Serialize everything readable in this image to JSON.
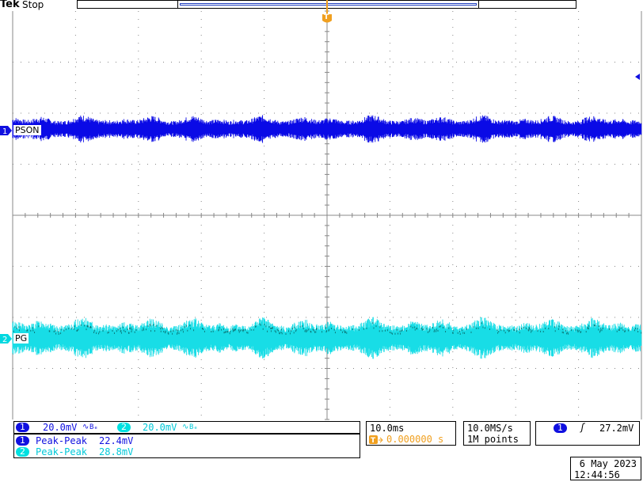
{
  "header": {
    "brand": "Tek",
    "status": "Stop"
  },
  "trigger_marker": {
    "label": "T"
  },
  "channels": [
    {
      "id": "1",
      "label": "PSON",
      "color": "#0a0ae6",
      "scale": "20.0mV",
      "coupling_symbol": "∿",
      "bw_symbol": "Bₑ"
    },
    {
      "id": "2",
      "label": "PG",
      "color": "#18dde6",
      "scale": "20.0mV",
      "coupling_symbol": "∿",
      "bw_symbol": "Bₑ"
    }
  ],
  "measurements": [
    {
      "channel": "1",
      "name": "Peak-Peak",
      "value": "22.4mV",
      "color": "#1010e0"
    },
    {
      "channel": "2",
      "name": "Peak-Peak",
      "value": "28.8mV",
      "color": "#00d0d8"
    }
  ],
  "timebase": {
    "scale": "10.0ms",
    "trigger_position": "0.000000 s"
  },
  "acquisition": {
    "rate": "10.0MS/s",
    "record_length": "1M points"
  },
  "trigger": {
    "channel": "1",
    "slope_symbol": "ʃ",
    "level": "27.2mV"
  },
  "datetime": {
    "date": "6 May 2023",
    "time": "12:44:56"
  },
  "colors": {
    "accent_trigger": "#f0a020",
    "ch1": "#0a0ae6",
    "ch2": "#18dde6",
    "ch2_dark": "#0a7070"
  }
}
